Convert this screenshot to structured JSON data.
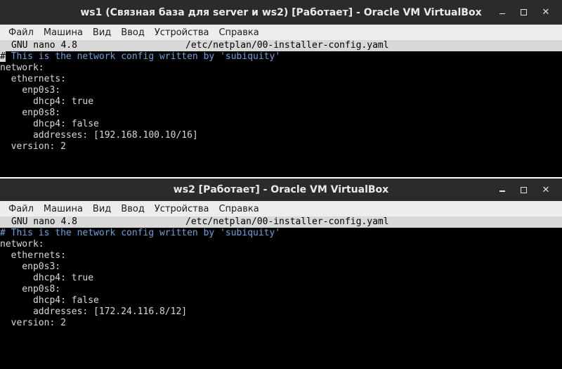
{
  "windows": [
    {
      "title": "ws1 (Связная база для server и ws2) [Работает] - Oracle VM VirtualBox",
      "menu": [
        "Файл",
        "Машина",
        "Вид",
        "Ввод",
        "Устройства",
        "Справка"
      ],
      "window_controls": {
        "minimize": "minimize-icon",
        "maximize": "maximize-icon",
        "close": "close-icon"
      },
      "nano": {
        "version": "GNU nano 4.8",
        "file": "/etc/netplan/00-installer-config.yaml"
      },
      "lines": {
        "comment_marker": "#",
        "comment_rest": " This is the network config written by 'subiquity'",
        "l1": "network:",
        "l2": "  ethernets:",
        "l3": "    enp0s3:",
        "l4": "      dhcp4: true",
        "l5": "    enp0s8:",
        "l6": "      dhcp4: false",
        "l7": "      addresses: [192.168.100.10/16]",
        "l8": "  version: 2"
      }
    },
    {
      "title": "ws2 [Работает] - Oracle VM VirtualBox",
      "menu": [
        "Файл",
        "Машина",
        "Вид",
        "Ввод",
        "Устройства",
        "Справка"
      ],
      "window_controls": {
        "minimize": "minimize-icon",
        "maximize": "maximize-icon",
        "close": "close-icon"
      },
      "nano": {
        "version": "GNU nano 4.8",
        "file": "/etc/netplan/00-installer-config.yaml"
      },
      "lines": {
        "comment_marker": "#",
        "comment_rest": " This is the network config written by 'subiquity'",
        "l1": "network:",
        "l2": "  ethernets:",
        "l3": "    enp0s3:",
        "l4": "      dhcp4: true",
        "l5": "    enp0s8:",
        "l6": "      dhcp4: false",
        "l7": "      addresses: [172.24.116.8/12]",
        "l8": "  version: 2"
      }
    }
  ],
  "colors": {
    "titlebar": "#2b2b2b",
    "menubar": "#ededed",
    "terminal_bg": "#000000",
    "terminal_fg": "#d8d8d8",
    "comment": "#6ca0dc",
    "nano_header": "#d8d8d8"
  }
}
